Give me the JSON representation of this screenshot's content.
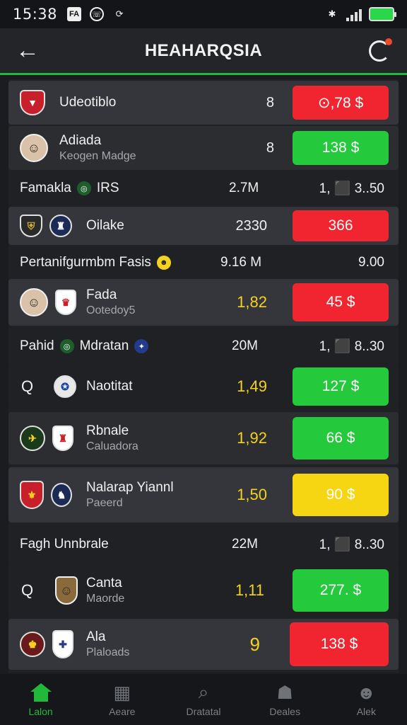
{
  "status_bar": {
    "time": "15:38",
    "icons": [
      "photo-icon",
      "whatsapp-icon",
      "sync-icon"
    ],
    "right_icons": [
      "bluetooth-icon",
      "signal-icon",
      "battery-icon"
    ]
  },
  "header": {
    "title": "HEAHARQSIA",
    "back_icon": "arrow-left-icon",
    "refresh_icon": "refresh-icon"
  },
  "rows": [
    {
      "type": "card",
      "name": "Udeotiblo",
      "sub": "",
      "mid": "8",
      "odds": "⊙,78 $",
      "odds_color": "red"
    },
    {
      "type": "card",
      "name": "Adiada",
      "sub": "Keogen Madge",
      "mid": "8",
      "odds": "138 $",
      "odds_color": "green"
    },
    {
      "type": "header",
      "label": "Famakla",
      "tag": "IRS",
      "mid": "2.7M",
      "right": "1, ⬛ 3..50"
    },
    {
      "type": "card",
      "name": "Oilake",
      "sub": "",
      "mid": "2330",
      "odds": "366",
      "odds_color": "red"
    },
    {
      "type": "header",
      "label": "Pertanifgurmbm Fasis",
      "tag": "",
      "mid": "9.16 M",
      "right": "9.00"
    },
    {
      "type": "card",
      "name": "Fada",
      "sub": "Ootedoy5",
      "mid": "1,82",
      "odds": "45 $",
      "odds_color": "red"
    },
    {
      "type": "header",
      "label": "Pahid",
      "tag": "Mdratan",
      "mid": "20M",
      "right": "1, ⬛ 8..30"
    },
    {
      "type": "card",
      "name": "Naotitat",
      "sub": "",
      "mid": "1,49",
      "odds": "127 $",
      "odds_color": "green"
    },
    {
      "type": "card",
      "name": "Rbnale",
      "sub": "Caluadora",
      "mid": "1,92",
      "odds": "66 $",
      "odds_color": "green"
    },
    {
      "type": "card",
      "name": "Nalarap Yiannl",
      "sub": "Paeerd",
      "mid": "1,50",
      "odds": "90 $",
      "odds_color": "yellow"
    },
    {
      "type": "header",
      "label": "Fagh Unnbrale",
      "tag": "",
      "mid": "22M",
      "right": "1, ⬛ 8..30"
    },
    {
      "type": "card",
      "name": "Canta",
      "sub": "Maorde",
      "mid": "1,11",
      "odds": "277. $",
      "odds_color": "green"
    },
    {
      "type": "card",
      "name": "Ala",
      "sub": "Plaloads",
      "mid": "9",
      "odds": "138 $",
      "odds_color": "red"
    }
  ],
  "bottom_nav": [
    {
      "label": "Lalon",
      "icon": "home-icon",
      "active": true
    },
    {
      "label": "Aeare",
      "icon": "grid-icon",
      "active": false
    },
    {
      "label": "Dratatal",
      "icon": "search-icon",
      "active": false
    },
    {
      "label": "Deales",
      "icon": "group-icon",
      "active": false
    },
    {
      "label": "Alek",
      "icon": "user-icon",
      "active": false
    }
  ],
  "colors": {
    "accent_green": "#22b93a",
    "odds_red": "#f0252f",
    "odds_green": "#24c93c",
    "odds_yellow": "#f6d612"
  }
}
